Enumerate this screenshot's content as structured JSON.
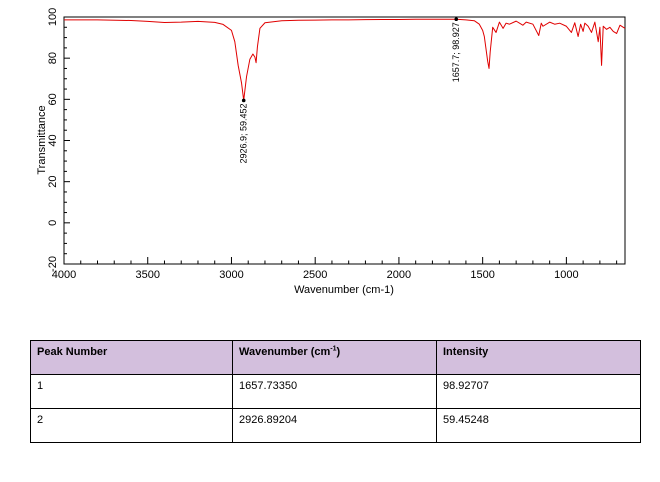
{
  "chart_data": {
    "type": "line",
    "xlabel": "Wavenumber (cm-1)",
    "ylabel": "Transmittance",
    "xlim": [
      4000,
      650
    ],
    "x_reversed": true,
    "ylim": [
      -20,
      100
    ],
    "x_ticks": [
      4000,
      3500,
      3000,
      2500,
      2000,
      1500,
      1000
    ],
    "y_ticks": [
      100,
      80,
      60,
      40,
      20,
      0,
      -20
    ],
    "grid": false,
    "line_color": "#e00000",
    "series": [
      {
        "x": [
          4000,
          3800,
          3600,
          3500,
          3400,
          3300,
          3200,
          3100,
          3050,
          3000,
          2980,
          2960,
          2940,
          2926.9,
          2910,
          2890,
          2872,
          2860,
          2853,
          2845,
          2830,
          2800,
          2700,
          2600,
          2500,
          2400,
          2300,
          2200,
          2100,
          2000,
          1900,
          1800,
          1700,
          1657.7,
          1600,
          1550,
          1520,
          1500,
          1490,
          1480,
          1470,
          1462,
          1455,
          1440,
          1420,
          1400,
          1378,
          1360,
          1340,
          1300,
          1260,
          1240,
          1200,
          1165,
          1150,
          1140,
          1100,
          1070,
          1040,
          1000,
          970,
          950,
          930,
          915,
          900,
          890,
          870,
          850,
          830,
          810,
          800,
          790,
          780,
          760,
          740,
          720,
          700,
          680,
          660,
          650
        ],
        "y": [
          98.6,
          98.6,
          98.3,
          97.9,
          97.3,
          97.5,
          97.9,
          97.4,
          96.4,
          93.5,
          88.0,
          76.5,
          68.0,
          59.5,
          71.0,
          79.5,
          82.0,
          80.5,
          77.8,
          85.5,
          94.5,
          97.2,
          98.2,
          98.4,
          98.5,
          98.6,
          98.6,
          98.7,
          98.8,
          98.8,
          98.9,
          98.9,
          98.9,
          98.9,
          98.6,
          98.2,
          96.5,
          93.5,
          90.5,
          84.5,
          78.5,
          75.0,
          83.0,
          95.0,
          92.5,
          97.5,
          94.5,
          97.0,
          96.5,
          98.0,
          96.0,
          97.5,
          96.5,
          91.0,
          97.0,
          95.5,
          97.5,
          96.5,
          97.0,
          95.5,
          92.5,
          97.2,
          90.5,
          96.5,
          93.0,
          97.0,
          95.5,
          92.5,
          97.5,
          88.0,
          95.0,
          76.5,
          95.5,
          94.0,
          95.0,
          93.0,
          92.0,
          96.0,
          95.0,
          94.5
        ]
      }
    ],
    "annotations": [
      {
        "x": 2926.9,
        "y": 59.452,
        "text": "2926.9; 59.452"
      },
      {
        "x": 1657.7,
        "y": 98.927,
        "text": "1657.7; 98.927"
      }
    ]
  },
  "table": {
    "headers": [
      "Peak Number",
      "Wavenumber (cm",
      "Intensity"
    ],
    "header_sup": "-1",
    "header_close": ")",
    "rows": [
      [
        "1",
        "1657.73350",
        "98.92707"
      ],
      [
        "2",
        "2926.89204",
        "59.45248"
      ]
    ],
    "header_bg": "#d3bfdd"
  }
}
